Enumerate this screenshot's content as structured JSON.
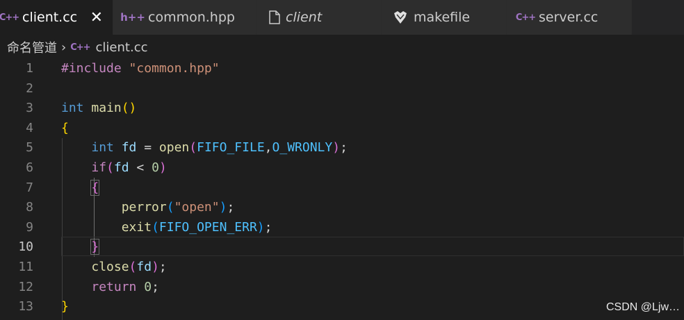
{
  "tabs": [
    {
      "label": "client.cc",
      "icon": "cpp-icon",
      "active": true,
      "close": "✕"
    },
    {
      "label": "common.hpp",
      "icon": "header-icon"
    },
    {
      "label": "client",
      "icon": "file-icon"
    },
    {
      "label": "makefile",
      "icon": "makefile-icon"
    },
    {
      "label": "server.cc",
      "icon": "cpp-icon"
    }
  ],
  "breadcrumb": {
    "folder": "命名管道",
    "file": "client.cc"
  },
  "editor": {
    "current_line": 10,
    "line_numbers": [
      "1",
      "2",
      "3",
      "4",
      "5",
      "6",
      "7",
      "8",
      "9",
      "10",
      "11",
      "12",
      "13"
    ],
    "lines": [
      "#include \"common.hpp\"",
      "",
      "int main()",
      "{",
      "    int fd = open(FIFO_FILE,O_WRONLY);",
      "    if(fd < 0)",
      "    {",
      "        perror(\"open\");",
      "        exit(FIFO_OPEN_ERR);",
      "    }",
      "    close(fd);",
      "    return 0;",
      "}"
    ]
  },
  "watermark": "CSDN @Ljw…",
  "colors": {
    "background": "#1e1e1e",
    "keyword": "#569cd6",
    "string": "#ce9178",
    "function": "#dcdcaa",
    "constant": "#4fc1ff",
    "preprocessor": "#c586c0"
  }
}
